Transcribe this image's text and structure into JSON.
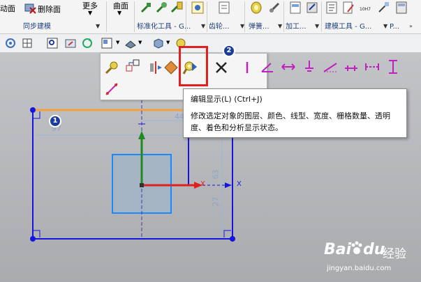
{
  "ribbon": {
    "left_truncated": "动面",
    "delete_face": "删除面",
    "more": "更多",
    "curved_face": "曲面",
    "groups": {
      "sync_modeling": "同步建模",
      "standard_parts": "标准化工具 - G...",
      "gear": "齿轮...",
      "spring": "弹簧...",
      "machining": "加工...",
      "modeling_tools": "建模工具 - G...",
      "p": "P..."
    },
    "fit_label": "10H7"
  },
  "tooltip": {
    "title": "编辑显示(L) (Ctrl+J)",
    "description": "修改选定对象的图层、颜色、线型、宽度、栅格数量、透明度、着色和分析显示状态。"
  },
  "badges": {
    "one": "1",
    "two": "2"
  },
  "dimensions": {
    "d97": "97",
    "d44": "44",
    "d63": "63",
    "d27": "27"
  },
  "axes": {
    "x1": "X",
    "x2": "X",
    "y": "Y"
  },
  "watermark": {
    "brand": "Bai",
    "brand2": "du",
    "jingyan": "经验",
    "url": "jingyan.baidu.com"
  },
  "colors": {
    "accent_red": "#e02020",
    "sketch_blue": "#1515e0",
    "badge_blue": "#1b3c9a",
    "highlight_orange": "#f5a040"
  }
}
